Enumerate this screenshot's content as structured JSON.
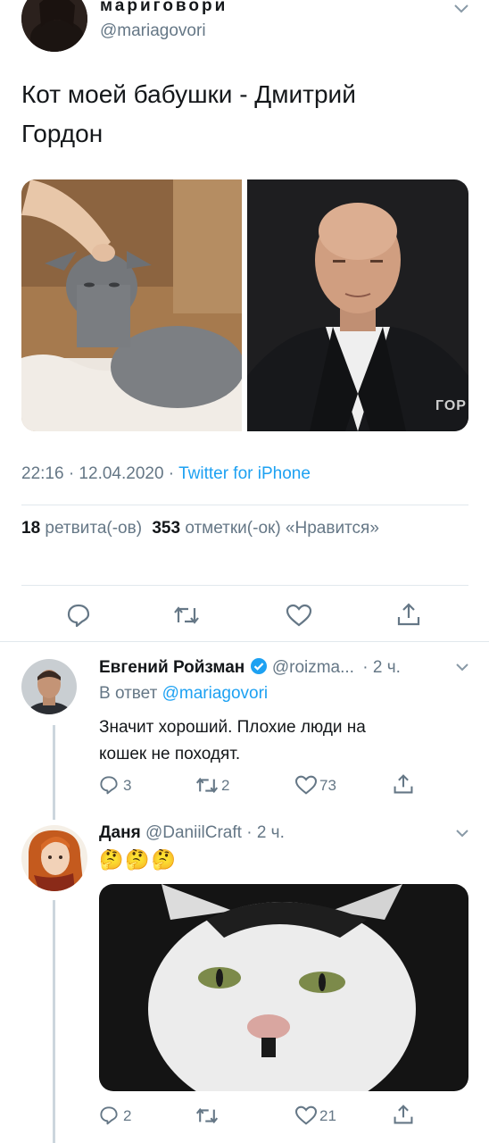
{
  "tweet": {
    "display_name": "мариговори",
    "handle": "@mariagovori",
    "text_line1": "Кот моей бабушки - Дмитрий",
    "text_line2": "Гордон",
    "image_watermark": "ГОР",
    "time": "22:16 · 12.04.2020 · ",
    "source": "Twitter for iPhone",
    "retweets": "18",
    "retweets_label": "ретвита(-ов)",
    "likes": "353",
    "likes_label": "отметки(-ок) «Нравится»"
  },
  "replies": [
    {
      "display_name": "Евгений Ройзман",
      "handle": "@roizma...",
      "time": "· 2 ч.",
      "reply_to_prefix": "В ответ ",
      "reply_to": "@mariagovori",
      "text_line1": "Значит хороший. Плохие люди на",
      "text_line2": "кошек не походят.",
      "replies_count": "3",
      "retweets_count": "2",
      "likes_count": "73"
    },
    {
      "display_name": "Даня",
      "handle": "@DaniilCraft",
      "time": "· 2 ч.",
      "emojis": "🤔🤔🤔",
      "replies_count": "2",
      "likes_count": "21"
    }
  ],
  "colors": {
    "accent": "#1da1f2",
    "muted": "#657786",
    "divider": "#e1e8ed",
    "verified": "#1da1f2"
  }
}
